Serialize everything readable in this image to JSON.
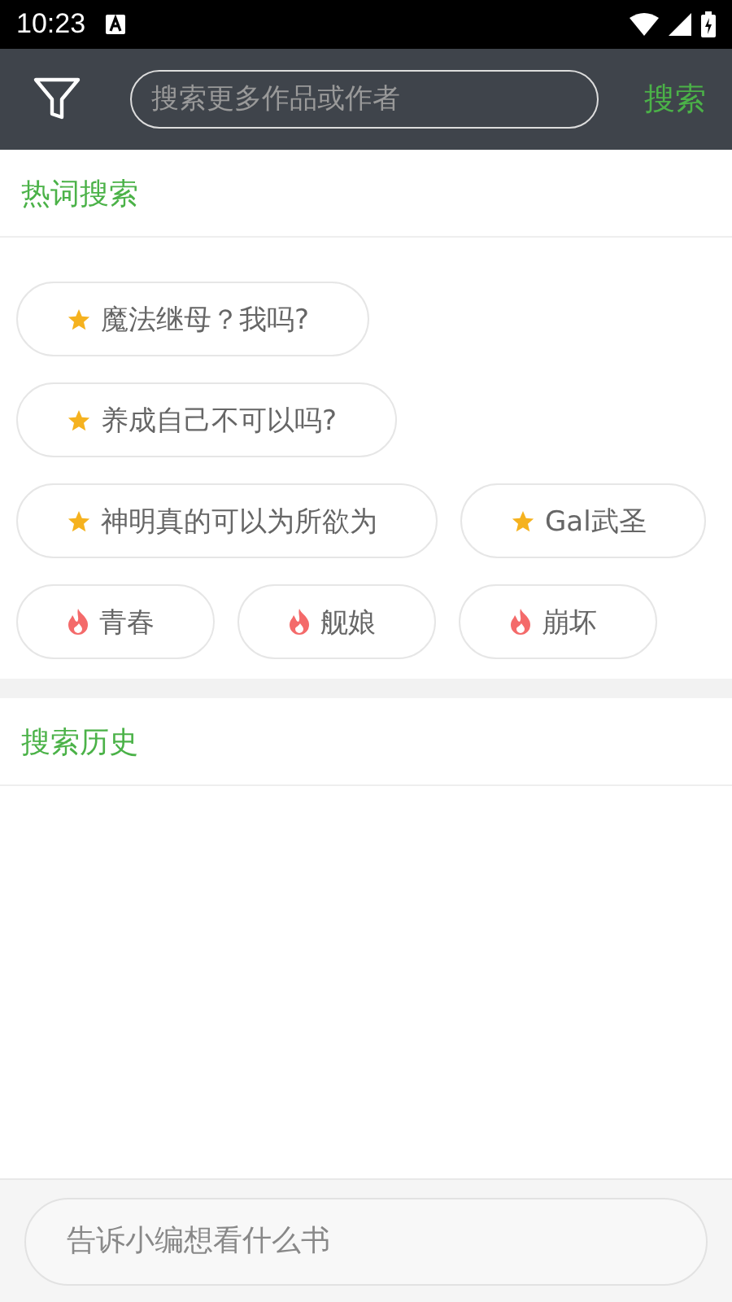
{
  "status_bar": {
    "time": "10:23"
  },
  "toolbar": {
    "search": {
      "placeholder": "搜索更多作品或作者"
    },
    "search_button": "搜索"
  },
  "hot_search": {
    "title": "热词搜索",
    "tags": [
      {
        "label": "魔法继母？我吗?",
        "kind": "star"
      },
      {
        "label": "养成自己不可以吗?",
        "kind": "star"
      },
      {
        "label": "神明真的可以为所欲为",
        "kind": "star"
      },
      {
        "label": "Gal武圣",
        "kind": "star"
      },
      {
        "label": "青春",
        "kind": "fire"
      },
      {
        "label": "舰娘",
        "kind": "fire"
      },
      {
        "label": "崩坏",
        "kind": "fire"
      }
    ]
  },
  "history": {
    "title": "搜索历史"
  },
  "bottom": {
    "placeholder": "告诉小编想看什么书"
  }
}
